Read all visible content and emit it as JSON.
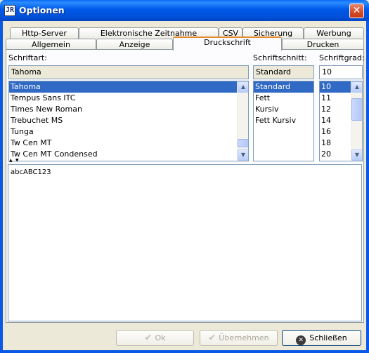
{
  "window": {
    "title": "Optionen",
    "app_icon_text": "JR",
    "close_glyph": "✕"
  },
  "tabs_row1": [
    "Http-Server",
    "Elektronische Zeitnahme",
    "CSV",
    "Sicherung",
    "Werbung"
  ],
  "tabs_row2": [
    "Allgemein",
    "Anzeige",
    "Druckschrift",
    "Drucken"
  ],
  "active_tab": "Druckschrift",
  "font": {
    "label": "Schriftart:",
    "value": "Tahoma",
    "items": [
      "Tahoma",
      "Tempus Sans ITC",
      "Times New Roman",
      "Trebuchet MS",
      "Tunga",
      "Tw Cen MT",
      "Tw Cen MT Condensed"
    ],
    "selected": "Tahoma"
  },
  "style": {
    "label": "Schriftschnitt:",
    "value": "Standard",
    "items": [
      "Standard",
      "Fett",
      "Kursiv",
      "Fett Kursiv"
    ],
    "selected": "Standard"
  },
  "size": {
    "label": "Schriftgrad:",
    "value": "10",
    "items": [
      "10",
      "11",
      "12",
      "14",
      "16",
      "18",
      "20"
    ],
    "selected": "10"
  },
  "preview_text": "abcABC123",
  "buttons": {
    "ok": "Ok",
    "apply": "Übernehmen",
    "close": "Schließen"
  },
  "colors": {
    "selection": "#316ac5",
    "active_tab_accent": "#e68b2c",
    "titlebar": "#0058e8"
  }
}
